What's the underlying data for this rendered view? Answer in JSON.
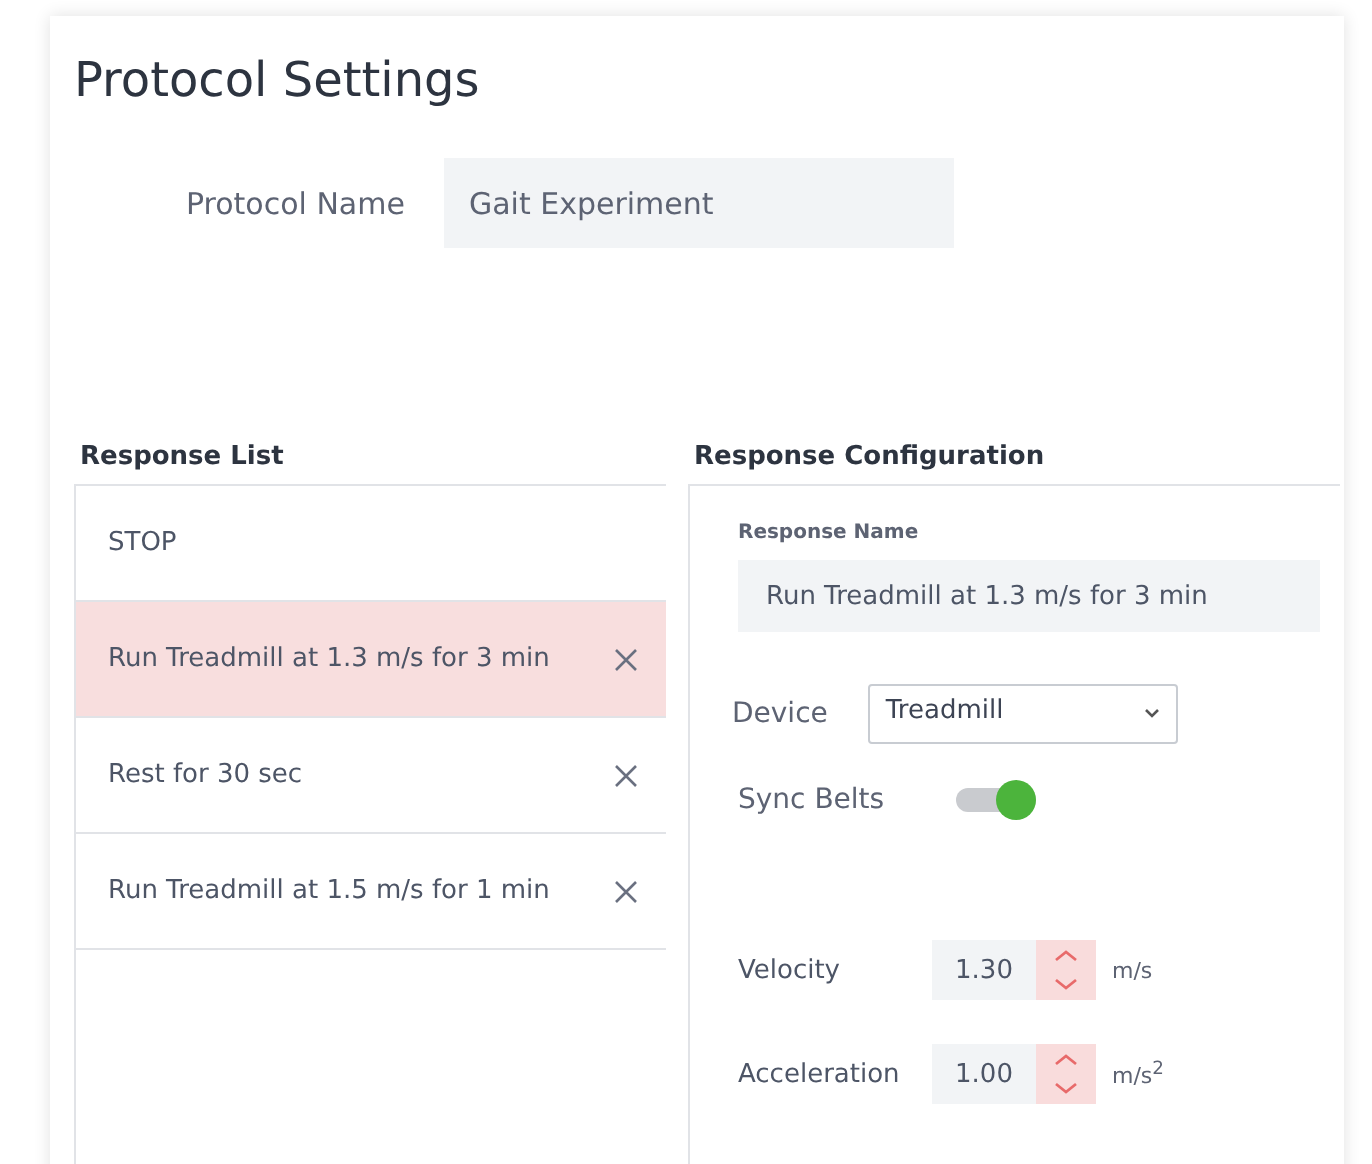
{
  "title": "Protocol Settings",
  "protocol_name": {
    "label": "Protocol Name",
    "value": "Gait Experiment"
  },
  "response_list": {
    "heading": "Response List",
    "items": [
      {
        "label": "STOP",
        "selected": false,
        "removable": false
      },
      {
        "label": "Run Treadmill at 1.3 m/s for 3 min",
        "selected": true,
        "removable": true
      },
      {
        "label": "Rest for 30 sec",
        "selected": false,
        "removable": true
      },
      {
        "label": "Run Treadmill at 1.5 m/s for 1 min",
        "selected": false,
        "removable": true
      }
    ]
  },
  "configuration": {
    "heading": "Response Configuration",
    "response_name": {
      "label": "Response Name",
      "value": "Run Treadmill at 1.3 m/s for 3 min"
    },
    "device": {
      "label": "Device",
      "value": "Treadmill"
    },
    "sync_belts": {
      "label": "Sync Belts",
      "on": true
    },
    "numbers": [
      {
        "label": "Velocity",
        "value": "1.30",
        "unit": "m/s"
      },
      {
        "label": "Acceleration",
        "value": "1.00",
        "unit": "m/s$^{2}$"
      }
    ]
  }
}
